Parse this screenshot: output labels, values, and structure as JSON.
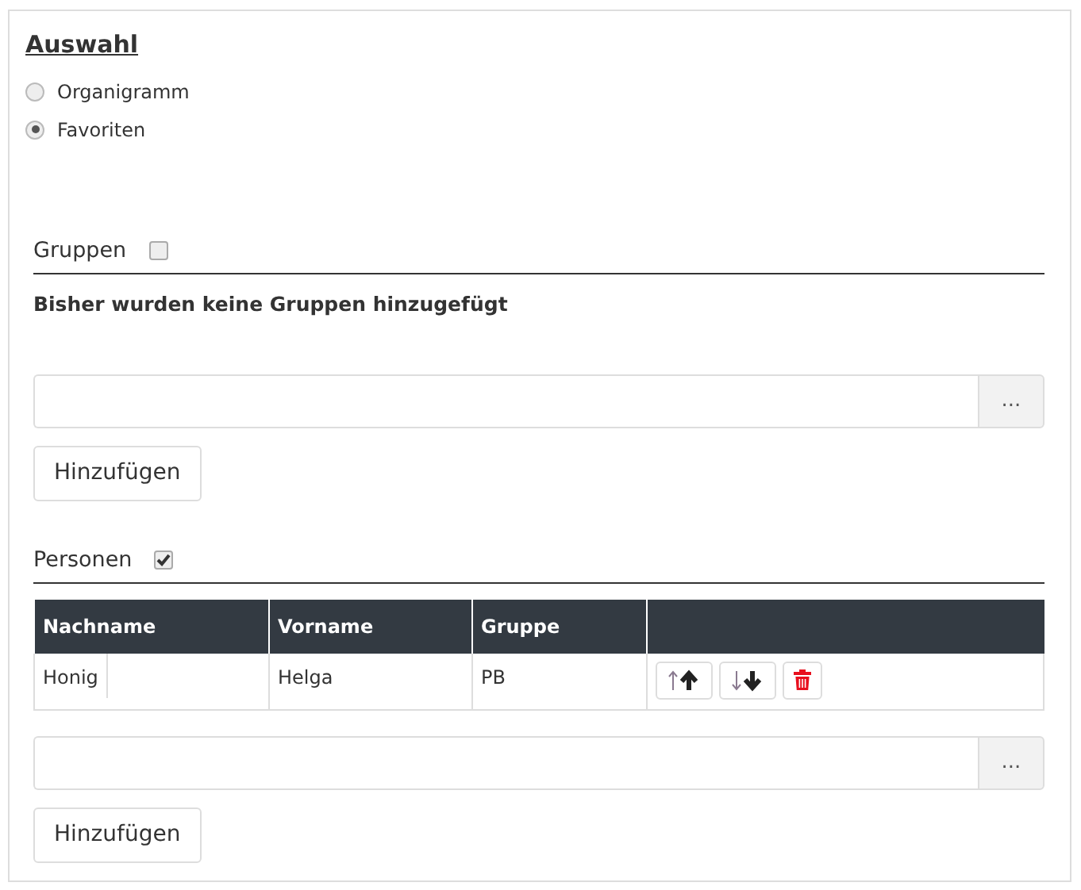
{
  "title": "Auswahl",
  "options": [
    {
      "label": "Organigramm",
      "selected": false
    },
    {
      "label": "Favoriten",
      "selected": true
    }
  ],
  "groups": {
    "label": "Gruppen",
    "checked": false,
    "empty_text": "Bisher wurden keine Gruppen hinzugefügt",
    "picker_button": "...",
    "add_button": "Hinzufügen"
  },
  "persons": {
    "label": "Personen",
    "checked": true,
    "columns": [
      "Nachname",
      "Vorname",
      "Gruppe"
    ],
    "rows": [
      {
        "cells": [
          "Honig",
          "Helga",
          "PB"
        ]
      }
    ],
    "picker_button": "...",
    "add_button": "Hinzufügen"
  }
}
